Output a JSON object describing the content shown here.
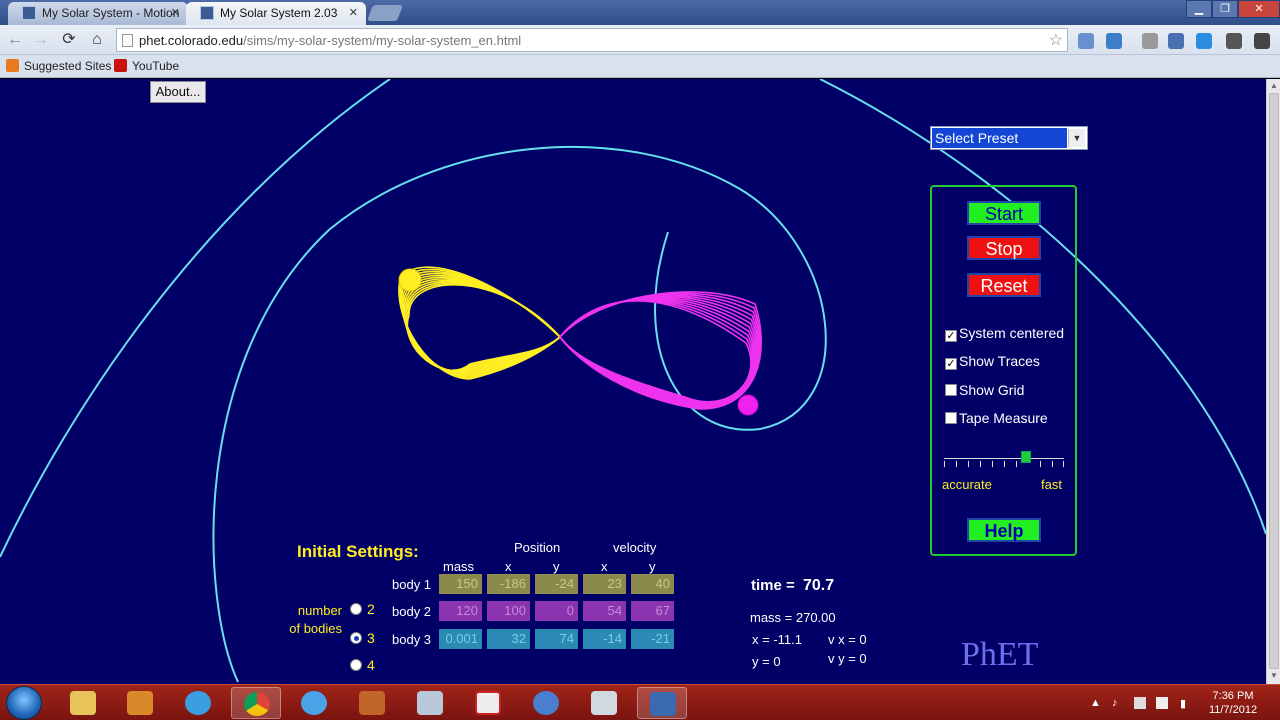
{
  "browser": {
    "tabs": [
      {
        "label": "My Solar System - Motion",
        "active": false
      },
      {
        "label": "My Solar System 2.03",
        "active": true
      }
    ],
    "window_buttons": {
      "minimize": "▁",
      "maximize": "❐",
      "close": "✕"
    },
    "nav_icons": {
      "back": "←",
      "forward": "→",
      "reload": "⟳",
      "home": "⌂"
    },
    "url": {
      "host": "phet.colorado.edu",
      "path": "/sims/my-solar-system/my-solar-system_en.html"
    },
    "star_icon": "☆",
    "bookmarks": [
      {
        "label": "Suggested Sites",
        "icon_color": "#e87a1c"
      },
      {
        "label": "YouTube",
        "icon_color": "#cc1111"
      }
    ]
  },
  "sim": {
    "about_label": "About...",
    "preset": {
      "value": "Select Preset",
      "arrow": "▼"
    },
    "controls": {
      "start": "Start",
      "stop": "Stop",
      "reset": "Reset",
      "help": "Help",
      "checkboxes": [
        {
          "label": "System centered",
          "checked": true
        },
        {
          "label": "Show Traces",
          "checked": true
        },
        {
          "label": "Show Grid",
          "checked": false
        },
        {
          "label": "Tape Measure",
          "checked": false
        }
      ],
      "speed_accurate": "accurate",
      "speed_fast": "fast",
      "speed_level": 0.7
    },
    "initial_settings": {
      "title": "Initial Settings:",
      "position_header": "Position",
      "velocity_header": "velocity",
      "col_mass": "mass",
      "col_x": "x",
      "col_y": "y",
      "col_vx": "x",
      "col_vy": "y",
      "bodies": [
        {
          "label": "body 1",
          "mass": "150",
          "x": "-186",
          "y": "-24",
          "vx": "23",
          "vy": "40"
        },
        {
          "label": "body 2",
          "mass": "120",
          "x": "100",
          "y": "0",
          "vx": "54",
          "vy": "67"
        },
        {
          "label": "body 3",
          "mass": "0.001",
          "x": "32",
          "y": "74",
          "vx": "-14",
          "vy": "-21"
        }
      ],
      "number_of_bodies_label": "number of bodies",
      "options": [
        "2",
        "3",
        "4"
      ],
      "selected": "3"
    },
    "readouts": {
      "time_label": "time =",
      "time_value": "70.7",
      "mass": "mass = 270.00",
      "x": "x = -11.1",
      "y": "y = 0",
      "vx": "v x = 0",
      "vy": "v y = 0"
    },
    "logo": "PhET",
    "colors": {
      "background": "#000066",
      "body1": "#ffee22",
      "body2": "#ee33ee",
      "body3_trace": "#66e0ee"
    }
  },
  "taskbar": {
    "time": "7:36 PM",
    "date": "11/7/2012"
  }
}
